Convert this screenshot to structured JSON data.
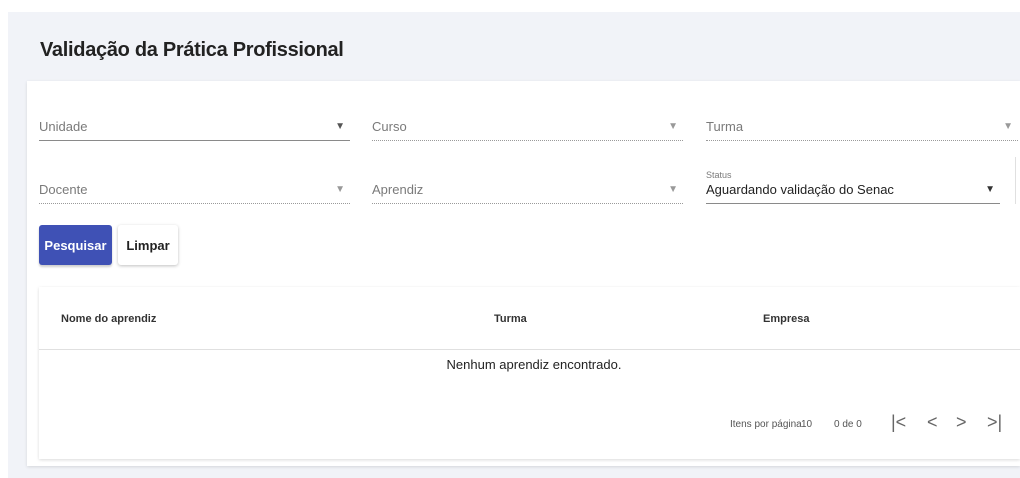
{
  "page": {
    "title": "Validação da Prática Profissional"
  },
  "filters": {
    "unidade": {
      "label": "Unidade"
    },
    "curso": {
      "label": "Curso"
    },
    "turma": {
      "label": "Turma"
    },
    "docente": {
      "label": "Docente"
    },
    "aprendiz": {
      "label": "Aprendiz"
    },
    "status": {
      "label": "Status",
      "value": "Aguardando validação do Senac"
    }
  },
  "actions": {
    "search": "Pesquisar",
    "clear": "Limpar"
  },
  "table": {
    "columns": [
      "Nome do aprendiz",
      "Turma",
      "Empresa"
    ],
    "empty_message": "Nenhum aprendiz encontrado."
  },
  "paginator": {
    "items_per_page_label": "Itens por página",
    "items_per_page_value": "10",
    "range": "0 de 0"
  },
  "icons": {
    "dropdown": "caret-down-icon",
    "first": "first-page-icon",
    "prev": "previous-page-icon",
    "next": "next-page-icon",
    "last": "last-page-icon"
  },
  "colors": {
    "primary": "#3f51b5",
    "background": "#f1f3f8"
  }
}
